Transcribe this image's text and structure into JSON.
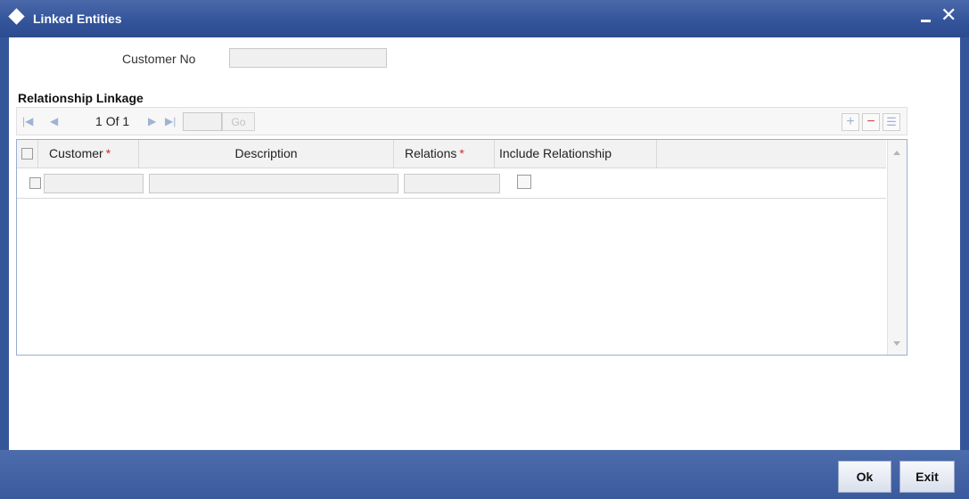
{
  "window": {
    "title": "Linked Entities",
    "close_glyph": "✕"
  },
  "form": {
    "customer_no_label": "Customer No",
    "customer_no_value": ""
  },
  "section": {
    "title": "Relationship Linkage"
  },
  "pager": {
    "current": "1",
    "of_label": "Of",
    "total": "1",
    "goto_value": "",
    "go_label": "Go"
  },
  "toolbar": {
    "add_glyph": "+",
    "delete_glyph": "−",
    "view_glyph": "☰"
  },
  "grid": {
    "columns": [
      {
        "label": "Customer",
        "required": true
      },
      {
        "label": "Description",
        "required": false
      },
      {
        "label": "Relations",
        "required": true
      },
      {
        "label": "Include Relationship",
        "required": false
      }
    ],
    "required_marker": "*",
    "rows": [
      {
        "customer": "",
        "description": "",
        "relations": "",
        "include_relationship": false
      }
    ]
  },
  "footer": {
    "ok_label": "Ok",
    "exit_label": "Exit"
  },
  "colors": {
    "titlebar": "#33539a",
    "required": "#d03030",
    "footer": "#3a5a9e"
  }
}
